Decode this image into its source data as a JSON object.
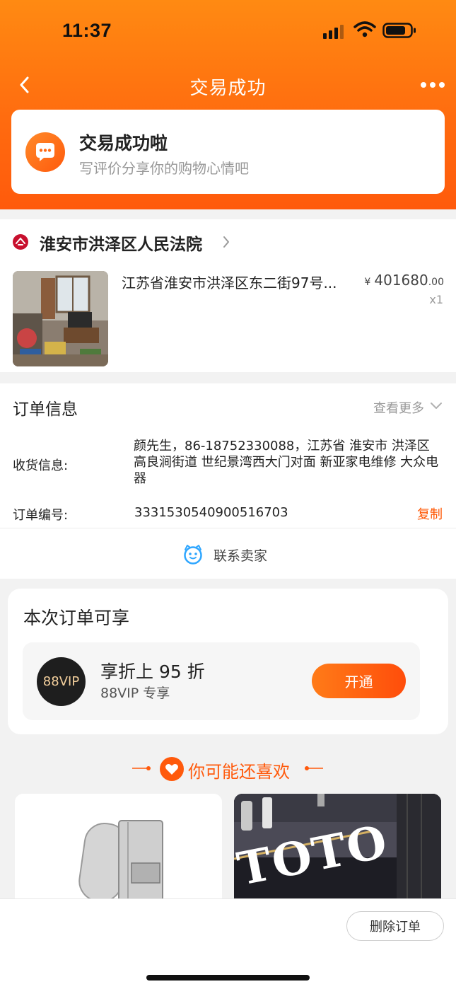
{
  "status_bar": {
    "time": "11:37"
  },
  "nav": {
    "title": "交易成功",
    "back_icon": "chevron-left-icon",
    "more_icon": "more-dots-icon"
  },
  "success_card": {
    "title": "交易成功啦",
    "subtitle": "写评价分享你的购物心情吧",
    "icon": "chat-bubble-icon"
  },
  "shop": {
    "name": "淮安市洪泽区人民法院",
    "product": {
      "title": "江苏省淮安市洪泽区东二街97号...",
      "price_symbol": "¥",
      "price_int": "401680",
      "price_dec": ".00",
      "quantity": "x1"
    }
  },
  "order_info": {
    "title": "订单信息",
    "see_more": "查看更多",
    "shipping_label": "收货信息:",
    "shipping_value": "颜先生，86-18752330088，江苏省 淮安市 洪泽区 高良涧街道 世纪景湾西大门对面 新亚家电维修 大众电器",
    "order_no_label": "订单编号:",
    "order_no_value": "3331530540900516703",
    "copy_label": "复制",
    "contact_seller": "联系卖家"
  },
  "vip": {
    "card_title": "本次订单可享",
    "badge": "88VIP",
    "title": "享折上 95 折",
    "subtitle": "88VIP 专享",
    "button": "开通"
  },
  "recommend": {
    "title": "你可能还喜欢",
    "card2_text": "TOTO"
  },
  "bottom_bar": {
    "delete_button": "删除订单"
  },
  "colors": {
    "accent": "#ff5a0c",
    "header_start": "#ff8a12",
    "header_end": "#ff5a0c"
  }
}
